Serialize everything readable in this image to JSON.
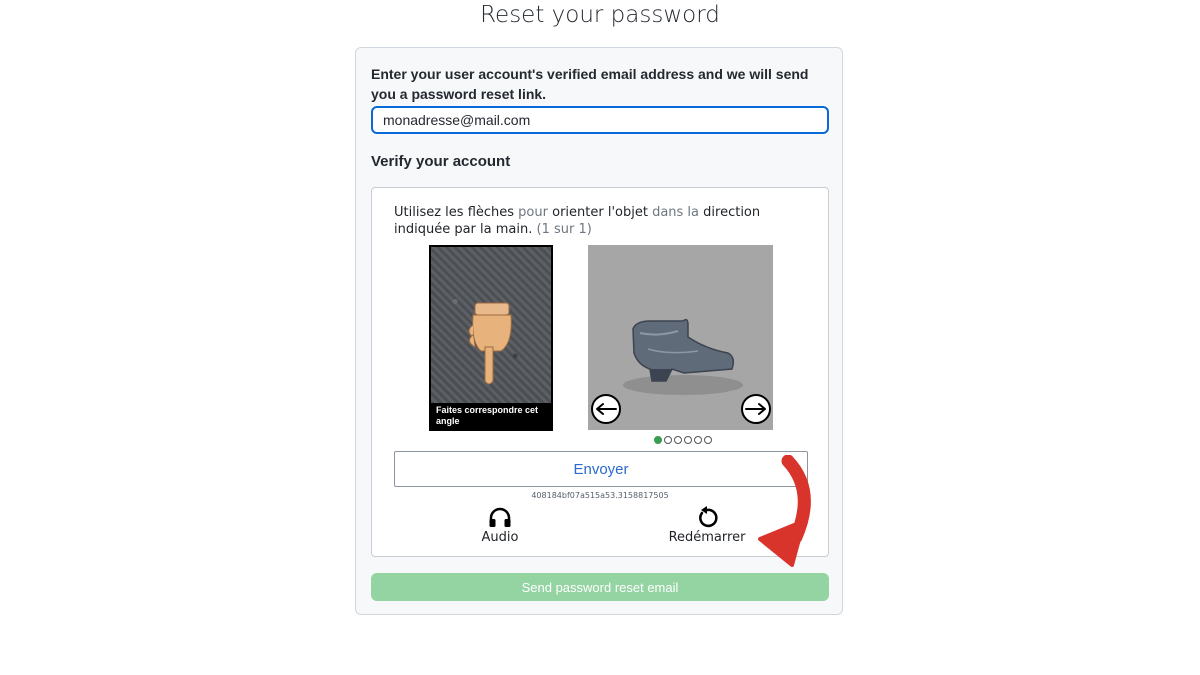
{
  "page": {
    "title": "Reset your password"
  },
  "form": {
    "instructions": "Enter your user account's verified email address and we will send you a password reset link.",
    "email_value": "monadresse@mail.com",
    "verify_heading": "Verify your account",
    "send_button_label": "Send password reset email",
    "send_button_color": "#94d3a2"
  },
  "captcha": {
    "instruction_parts": [
      "Utilisez les flèches",
      " pour ",
      "orienter l'objet",
      " dans la ",
      "direction indiquée par la main",
      ". ",
      "(1 sur 1)"
    ],
    "reference_caption": "Faites correspondre cet angle",
    "reference_icon": "pointing-hand-icon",
    "object_icon": "ankle-boot",
    "arrow_left_icon": "arrow-left-icon",
    "arrow_right_icon": "arrow-right-icon",
    "progress_dots_total": 6,
    "progress_dots_active": 1,
    "submit_label": "Envoyer",
    "session_id": "408184bf07a515a53.3158817505",
    "audio_label": "Audio",
    "audio_icon": "headphones-icon",
    "restart_label": "Redémarrer",
    "restart_icon": "restart-icon",
    "accent_color": "#2b6ad0"
  },
  "annotation": {
    "arrow_color": "#d9342b",
    "arrow_icon": "curved-arrow-icon"
  }
}
